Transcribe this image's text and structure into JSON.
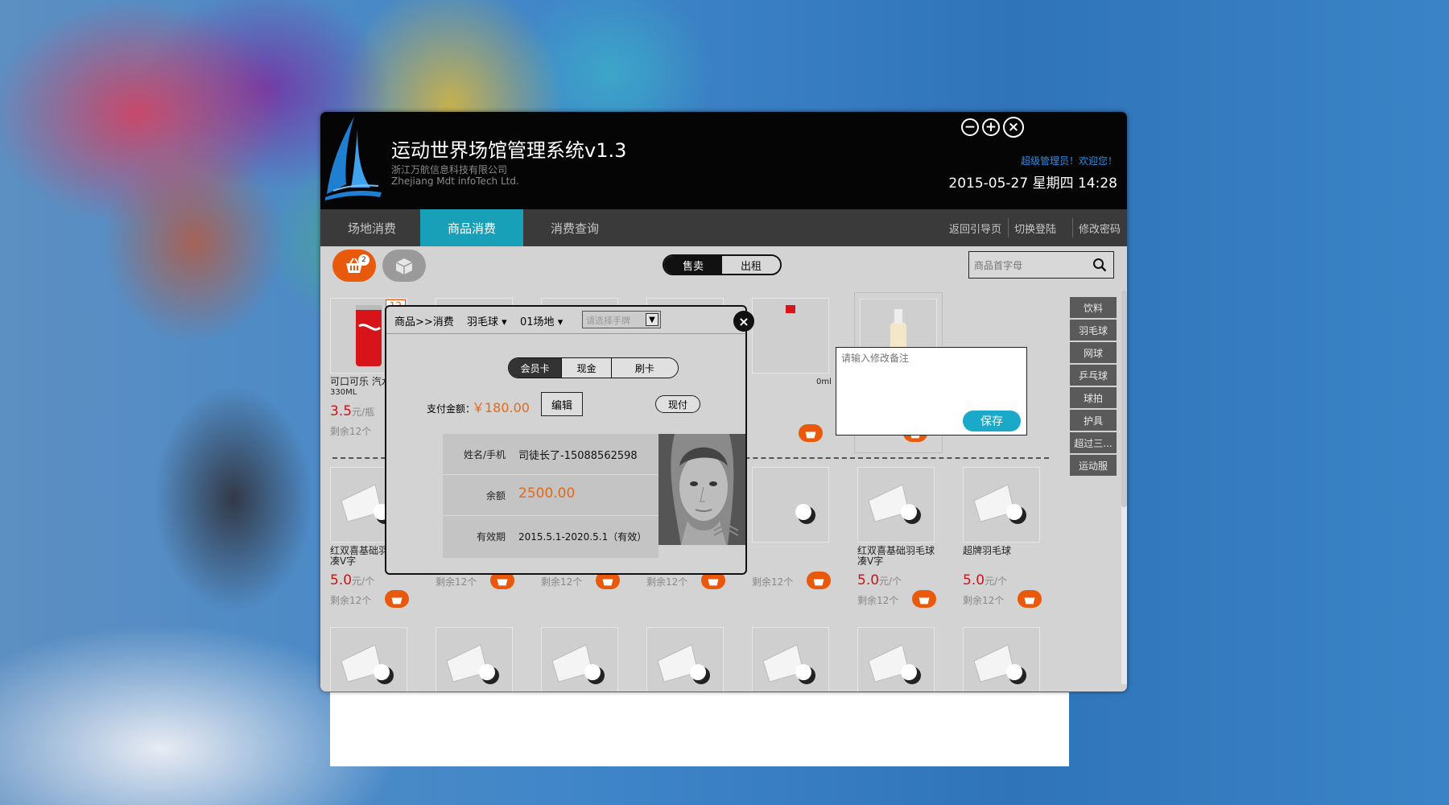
{
  "app": {
    "title": "运动世界场馆管理系统v1.3",
    "company_cn": "浙江万航信息科技有限公司",
    "company_en": "Zhejiang Mdt infoTech Ltd.",
    "welcome": "超级管理员！欢迎您！",
    "datetime": "2015-05-27 星期四 14:28"
  },
  "nav": {
    "tabs": [
      "场地消费",
      "商品消费",
      "消费查询"
    ],
    "links": [
      "返回引导页",
      "切换登陆",
      "修改密码"
    ]
  },
  "toolbar": {
    "cart_count": "2",
    "mode": [
      "售卖",
      "出租"
    ],
    "search_placeholder": "商品首字母"
  },
  "products": {
    "row1": [
      {
        "name": "可口可乐 汽水",
        "spec": "330ML",
        "price": "3.5",
        "unit": "元/瓶",
        "stock": "剩余12个",
        "badge": "12"
      },
      {
        "name": "",
        "spec": "",
        "price": "",
        "unit": "",
        "stock": ""
      },
      {
        "name": "",
        "spec": "",
        "price": "",
        "unit": "",
        "stock": ""
      },
      {
        "name": "",
        "spec": "",
        "price": "",
        "unit": "",
        "stock": ""
      },
      {
        "name": "",
        "spec": "0ml",
        "price": "",
        "unit": "",
        "stock": ""
      }
    ],
    "row2": [
      {
        "name": "红双喜基础羽毛球 凑V字",
        "price": "5.0",
        "unit": "元/个",
        "stock": "剩余12个"
      },
      {
        "name": "",
        "price": "",
        "unit": "",
        "stock": "剩余12个"
      },
      {
        "name": "",
        "price": "",
        "unit": "",
        "stock": "剩余12个"
      },
      {
        "name": "",
        "price": "",
        "unit": "",
        "stock": "剩余12个"
      },
      {
        "name": "",
        "price": "",
        "unit": "",
        "stock": "剩余12个"
      },
      {
        "name": "红双喜基础羽毛球 凑V字",
        "price": "5.0",
        "unit": "元/个",
        "stock": "剩余12个"
      },
      {
        "name": "超牌羽毛球",
        "price": "5.0",
        "unit": "元/个",
        "stock": "剩余12个"
      }
    ]
  },
  "categories": [
    "饮料",
    "羽毛球",
    "网球",
    "乒乓球",
    "球拍",
    "护具",
    "超过三...",
    "运动服"
  ],
  "remark": {
    "placeholder": "请输入修改备注",
    "save_label": "保存"
  },
  "dialog": {
    "breadcrumb": "商品>>消费",
    "sport": "羽毛球",
    "court": "01场地",
    "wristband_placeholder": "请选择手牌",
    "pay_methods": [
      "会员卡",
      "现金",
      "刷卡"
    ],
    "amount_label": "支付金额：",
    "amount": "￥180.00",
    "edit_label": "编辑",
    "cash_label": "现付",
    "member": {
      "name_label": "姓名/手机",
      "name_value": "司徒长了-15088562598",
      "balance_label": "余额",
      "balance_value": "2500.00",
      "validity_label": "有效期",
      "validity_value": "2015.5.1-2020.5.1（有效）"
    }
  },
  "colors": {
    "accent_teal": "#17a0b8",
    "accent_orange": "#e8590c",
    "price_red": "#c2171a",
    "balance_orange": "#e26a1a"
  }
}
